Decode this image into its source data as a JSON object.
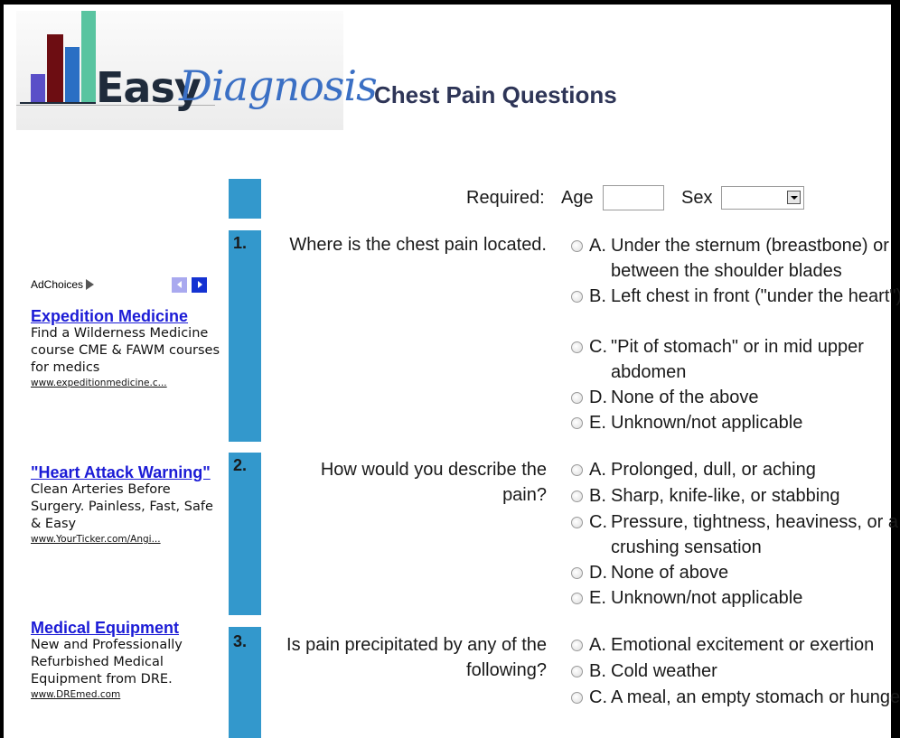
{
  "brand": {
    "word1": "Easy",
    "word2": "Diagnosis"
  },
  "page_title": "Chest Pain Questions",
  "required": {
    "label": "Required:",
    "age_label": "Age",
    "age_value": "",
    "sex_label": "Sex",
    "sex_value": ""
  },
  "questions": [
    {
      "number": "1.",
      "text": "Where is the chest pain located.",
      "options": [
        {
          "letter": "A.",
          "text": "Under the sternum (breastbone) or between the shoulder blades"
        },
        {
          "letter": "B.",
          "text": "Left chest in front (\"under the heart\")"
        },
        {
          "letter": "C.",
          "text": "\"Pit of stomach\" or in mid upper abdomen"
        },
        {
          "letter": "D.",
          "text": "None of the above"
        },
        {
          "letter": "E.",
          "text": "Unknown/not applicable"
        }
      ]
    },
    {
      "number": "2.",
      "text": "How would you describe the pain?",
      "options": [
        {
          "letter": "A.",
          "text": "Prolonged, dull, or aching"
        },
        {
          "letter": "B.",
          "text": "Sharp, knife-like, or stabbing"
        },
        {
          "letter": "C.",
          "text": "Pressure, tightness, heaviness, or a crushing sensation"
        },
        {
          "letter": "D.",
          "text": "None of above"
        },
        {
          "letter": "E.",
          "text": "Unknown/not applicable"
        }
      ]
    },
    {
      "number": "3.",
      "text": "Is pain precipitated by any of the following?",
      "options": [
        {
          "letter": "A.",
          "text": "Emotional excitement or exertion"
        },
        {
          "letter": "B.",
          "text": "Cold weather"
        },
        {
          "letter": "C.",
          "text": "A meal, an empty stomach or hunger"
        }
      ]
    }
  ],
  "ads": {
    "adchoices_label": "AdChoices",
    "items": [
      {
        "title": "Expedition Medicine",
        "description": "Find a Wilderness Medicine course CME & FAWM courses for medics",
        "url": "www.expeditionmedicine.c..."
      },
      {
        "title": "\"Heart Attack Warning\"",
        "description": "Clean Arteries Before Surgery. Painless, Fast, Safe & Easy",
        "url": "www.YourTicker.com/Angi..."
      },
      {
        "title": "Medical Equipment",
        "description": "New and Professionally Refurbished Medical Equipment from DRE.",
        "url": "www.DREmed.com"
      }
    ]
  },
  "colors": {
    "accent_bar": "#3398cc",
    "title": "#2e3557",
    "ad_link": "#1b1bd6"
  },
  "icons": {
    "ad_prev": "chevron-left-icon",
    "ad_next": "chevron-right-icon",
    "adchoices": "adchoices-triangle-icon"
  }
}
